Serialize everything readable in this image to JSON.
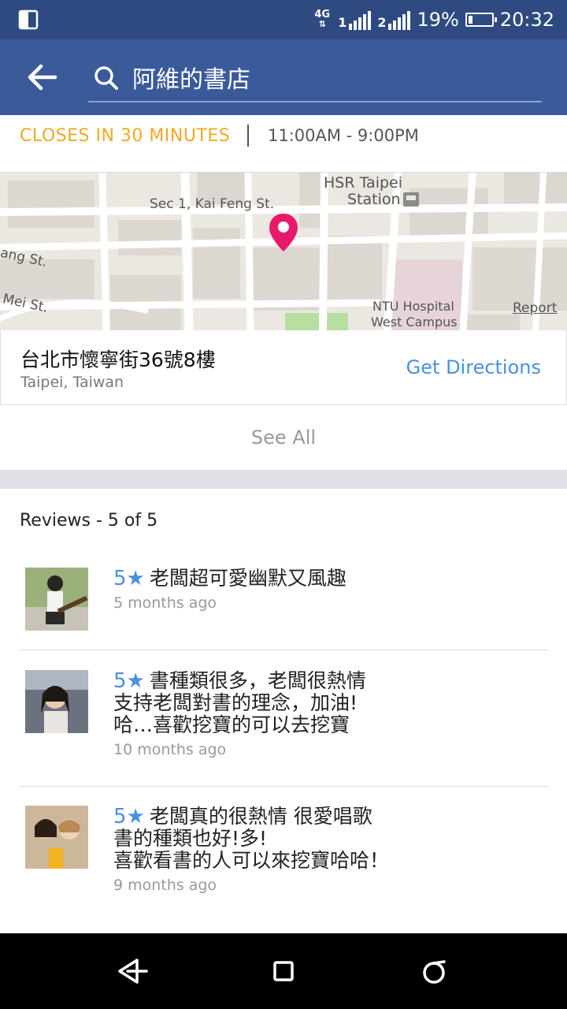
{
  "status_bar": {
    "network": "4G",
    "sim1": "1",
    "sim2": "2",
    "battery_percent": "19%",
    "battery_level": 0.19,
    "time": "20:32"
  },
  "app_bar": {
    "search_value": "阿維的書店"
  },
  "hours": {
    "status": "CLOSES IN 30 MINUTES",
    "range": "11:00AM - 9:00PM"
  },
  "map": {
    "labels": {
      "street1": "Sec 1, Kai Feng St.",
      "station_line1": "HSR Taipei",
      "station_line2": "Station",
      "street2": "ang St.",
      "street3": "Mei St.",
      "hospital_line1": "NTU Hospital",
      "hospital_line2": "West Campus"
    },
    "report": "Report",
    "pin_color": "#e8196b"
  },
  "address": {
    "line": "台北市懷寧街36號8樓",
    "city": "Taipei, Taiwan",
    "directions": "Get Directions"
  },
  "see_all": "See All",
  "reviews": {
    "title": "Reviews - 5 of 5",
    "items": [
      {
        "rating": "5★",
        "text": "老闆超可愛幽默又風趣",
        "time": "5 months ago"
      },
      {
        "rating": "5★",
        "text": "書種類很多，老闆很熱情\n支持老闆對書的理念，加油!\n哈…喜歡挖寶的可以去挖寶",
        "time": "10 months ago"
      },
      {
        "rating": "5★",
        "text": "老闆真的很熱情 很愛唱歌\n書的種類也好!多!\n喜歡看書的人可以來挖寶哈哈！",
        "time": "9 months ago"
      }
    ]
  },
  "colors": {
    "status_bar": "#2e4a80",
    "app_bar": "#3b5a9a",
    "hours_accent": "#f2a825",
    "link": "#4a90e2"
  },
  "icons": {
    "back": "arrow-left-icon",
    "search": "search-icon",
    "nav_back": "triangle-back-icon",
    "nav_home": "square-home-icon",
    "nav_recent": "circle-recent-icon"
  }
}
